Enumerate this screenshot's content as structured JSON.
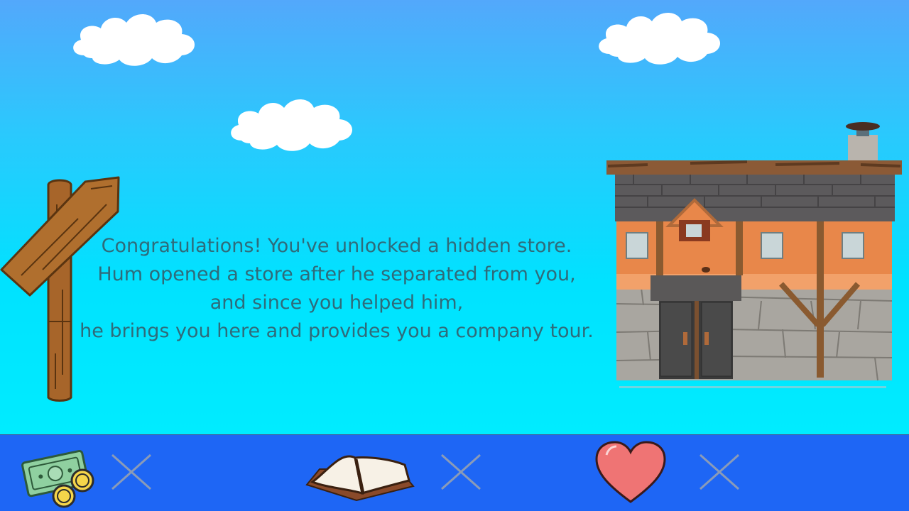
{
  "story": {
    "lines": [
      "Congratulations! You've unlocked a hidden store.",
      "Hum opened a store after he separated from you,",
      "and since you helped him,",
      "he brings you here and provides you a company tour."
    ]
  },
  "hud": {
    "money": {
      "icon": "money-icon",
      "status": "x-mark-icon"
    },
    "knowledge": {
      "icon": "book-icon",
      "status": "x-mark-icon"
    },
    "health": {
      "icon": "heart-icon",
      "status": "x-mark-icon"
    }
  },
  "colors": {
    "sky_top": "#53a8fb",
    "sky_bottom": "#00ecff",
    "hud_bar": "#1e66f5",
    "text": "#2f6b7a",
    "x_mark": "#8a9bb8"
  }
}
